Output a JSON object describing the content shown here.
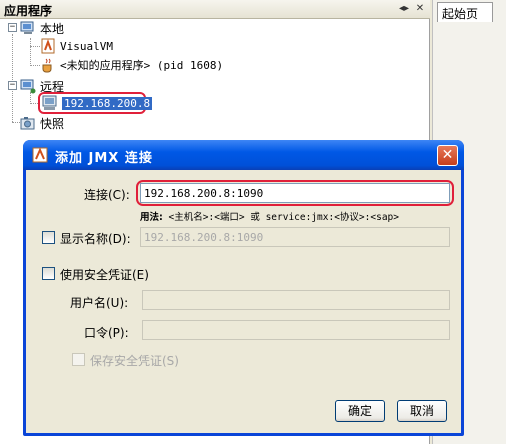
{
  "app_panel": {
    "title": "应用程序",
    "header_buttons": [
      "◂▸",
      "✕"
    ]
  },
  "tree": {
    "local": {
      "label": "本地",
      "expander": "−"
    },
    "visualvm": {
      "label": "VisualVM"
    },
    "unknown_app": {
      "label": "<未知的应用程序> (pid 1608)"
    },
    "remote": {
      "label": "远程",
      "expander": "−"
    },
    "remote_host": {
      "label": "192.168.200.8"
    },
    "snapshots": {
      "label": "快照"
    }
  },
  "right_tab": {
    "label": "起始页"
  },
  "dialog": {
    "title": "添加 JMX 连接",
    "close_glyph": "✕",
    "connection": {
      "label": "连接(C):",
      "value": "192.168.200.8:1090"
    },
    "usage_hint_bold": "用法:",
    "usage_hint": "<主机名>:<端口> 或 service:jmx:<协议>:<sap>",
    "display_name": {
      "label": "显示名称(D):",
      "value": "192.168.200.8:1090",
      "checked": false
    },
    "use_credentials": {
      "label": "使用安全凭证(E)",
      "checked": false
    },
    "username": {
      "label": "用户名(U):",
      "value": ""
    },
    "password": {
      "label": "口令(P):",
      "value": ""
    },
    "save_credentials": {
      "label": "保存安全凭证(S)",
      "checked": false
    },
    "ok_label": "确定",
    "cancel_label": "取消"
  },
  "colors": {
    "dialog_title": "#0058e6",
    "selection": "#316ac5",
    "highlight_ring": "#e0203a"
  }
}
